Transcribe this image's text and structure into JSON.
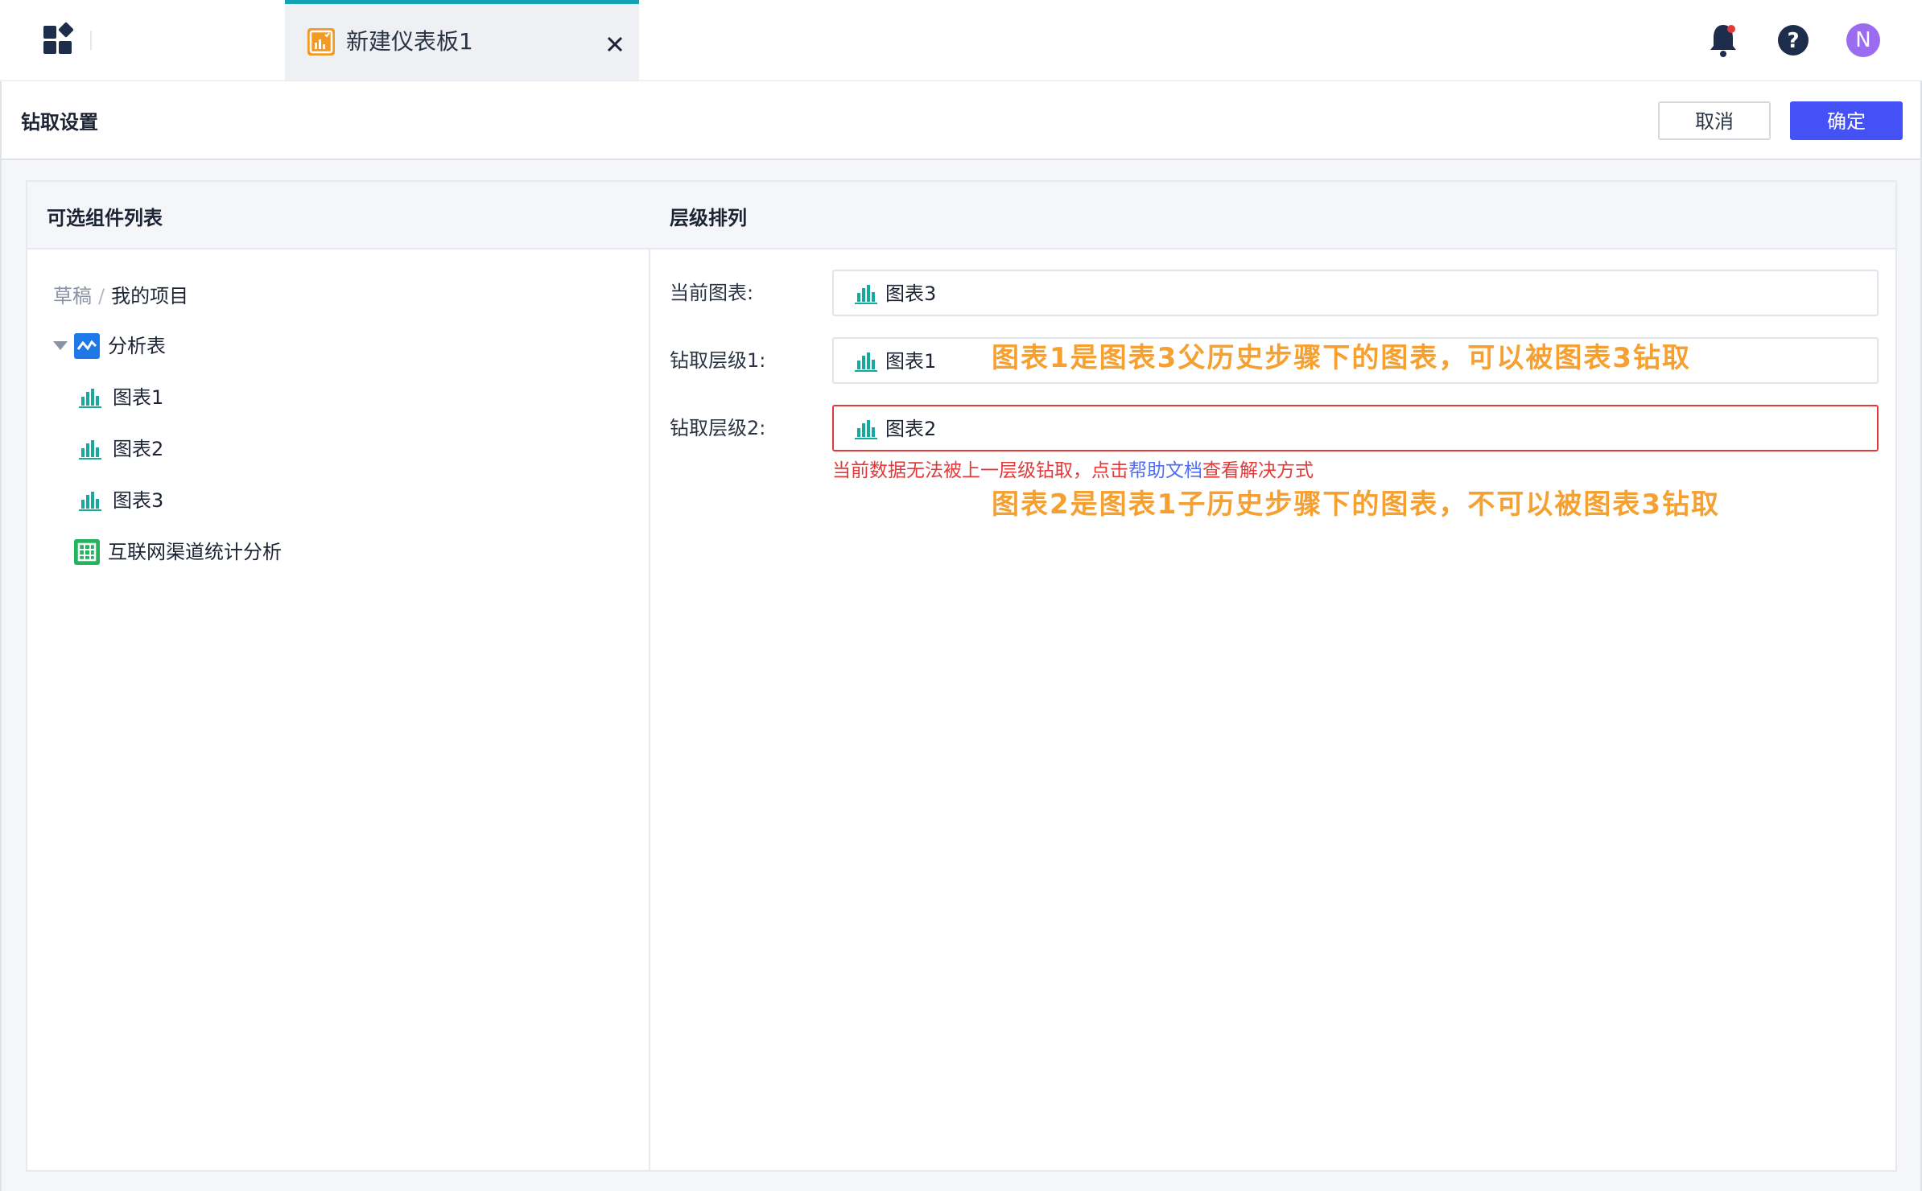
{
  "topbar": {
    "tab_title": "新建仪表板1",
    "avatar_letter": "N",
    "icons": [
      "app-grid-icon",
      "dashboard-icon",
      "close-icon",
      "bell-icon",
      "help-icon"
    ]
  },
  "header": {
    "title": "钻取设置",
    "cancel_label": "取消",
    "ok_label": "确定"
  },
  "panel": {
    "left_title": "可选组件列表",
    "right_title": "层级排列"
  },
  "tree": {
    "breadcrumb_root": "草稿",
    "breadcrumb_sep": "/",
    "breadcrumb_current": "我的项目",
    "analysis_table": "分析表",
    "charts": [
      {
        "label": "图表1"
      },
      {
        "label": "图表2"
      },
      {
        "label": "图表3"
      }
    ],
    "data_table": "互联网渠道统计分析"
  },
  "form": {
    "current_label": "当前图表:",
    "current_value": "图表3",
    "level1_label": "钻取层级1:",
    "level1_value": "图表1",
    "level2_label": "钻取层级2:",
    "level2_value": "图表2",
    "error_prefix": "当前数据无法被上一层级钻取，点击",
    "error_link": "帮助文档",
    "error_suffix": "查看解决方式"
  },
  "annotations": {
    "note1": "图表1是图表3父历史步骤下的图表，可以被图表3钻取",
    "note2": "图表2是图表1子历史步骤下的图表，不可以被图表3钻取"
  },
  "colors": {
    "accent": "#4452f5",
    "tab_indicator": "#12a4b4",
    "error": "#e13a3a",
    "annotation": "#f5a030",
    "chart_icon": "#17a99b"
  }
}
